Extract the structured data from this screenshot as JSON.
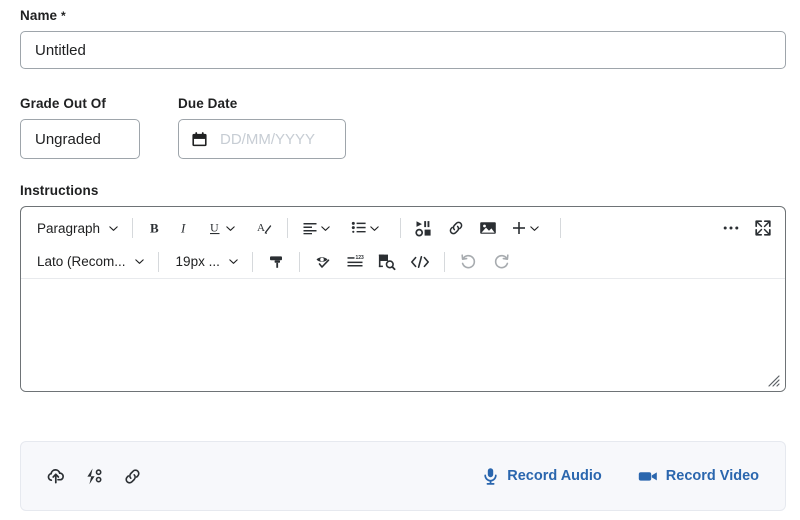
{
  "form": {
    "name_field": {
      "label": "Name",
      "required_marker": "*",
      "value": "Untitled",
      "placeholder": ""
    },
    "grade_field": {
      "label": "Grade Out Of",
      "value": "Ungraded",
      "placeholder": ""
    },
    "due_date_field": {
      "label": "Due Date",
      "value": "",
      "placeholder": "DD/MM/YYYY",
      "icon": "calendar-icon"
    },
    "instructions_field": {
      "label": "Instructions",
      "value": ""
    }
  },
  "editor": {
    "toolbar_row1": [
      {
        "type": "combo",
        "name": "paragraph-format-select",
        "label": "Paragraph",
        "icon": "chevron-down-icon"
      },
      {
        "type": "sep"
      },
      {
        "type": "icon",
        "name": "bold-button",
        "icon": "bold-icon",
        "label": "Bold"
      },
      {
        "type": "icon",
        "name": "italic-button",
        "icon": "italic-icon",
        "label": "Italic"
      },
      {
        "type": "icon-chev",
        "name": "underline-button",
        "icon": "underline-icon",
        "label": "Underline"
      },
      {
        "type": "icon",
        "name": "text-color-button",
        "icon": "text-color-icon",
        "label": "Text Color"
      },
      {
        "type": "sep"
      },
      {
        "type": "icon-chev",
        "name": "align-button",
        "icon": "align-left-icon",
        "label": "Align"
      },
      {
        "type": "icon-chev",
        "name": "list-button",
        "icon": "bullet-list-icon",
        "label": "Lists"
      },
      {
        "type": "sep"
      },
      {
        "type": "icon",
        "name": "insert-media-button",
        "icon": "media-icon",
        "label": "Insert Media"
      },
      {
        "type": "icon",
        "name": "insert-link-button",
        "icon": "link-icon",
        "label": "Insert Link"
      },
      {
        "type": "icon",
        "name": "insert-image-button",
        "icon": "image-icon",
        "label": "Insert Image"
      },
      {
        "type": "icon-chev",
        "name": "insert-more-button",
        "icon": "plus-icon",
        "label": "Insert"
      },
      {
        "type": "sep"
      },
      {
        "type": "spacer"
      },
      {
        "type": "icon",
        "name": "more-options-button",
        "icon": "ellipsis-icon",
        "label": "More"
      },
      {
        "type": "icon",
        "name": "fullscreen-button",
        "icon": "fullscreen-icon",
        "label": "Fullscreen"
      }
    ],
    "toolbar_row2": [
      {
        "type": "combo",
        "name": "font-family-select",
        "label": "Lato (Recom...",
        "icon": "chevron-down-icon"
      },
      {
        "type": "sep"
      },
      {
        "type": "combo",
        "name": "font-size-select",
        "label": "19px ...",
        "icon": "chevron-down-icon"
      },
      {
        "type": "sep"
      },
      {
        "type": "icon",
        "name": "format-painter-button",
        "icon": "paint-roller-icon",
        "label": "Format Painter"
      },
      {
        "type": "sep"
      },
      {
        "type": "icon",
        "name": "accessibility-checker-button",
        "icon": "accessibility-check-icon",
        "label": "Accessibility Checker"
      },
      {
        "type": "icon",
        "name": "word-count-button",
        "icon": "word-count-icon",
        "label": "Word Count"
      },
      {
        "type": "icon",
        "name": "find-replace-button",
        "icon": "find-replace-icon",
        "label": "Find and Replace"
      },
      {
        "type": "icon",
        "name": "source-code-button",
        "icon": "code-icon",
        "label": "Source Code"
      },
      {
        "type": "sep"
      },
      {
        "type": "icon-disabled",
        "name": "undo-button",
        "icon": "undo-icon",
        "label": "Undo"
      },
      {
        "type": "icon-disabled",
        "name": "redo-button",
        "icon": "redo-icon",
        "label": "Redo"
      }
    ],
    "content": "",
    "resize_handle": "resize-grip-icon"
  },
  "attachment_bar": {
    "icons": [
      {
        "name": "upload-file-button",
        "icon": "cloud-upload-icon",
        "label": "Upload"
      },
      {
        "name": "quicklink-button",
        "icon": "quicklink-icon",
        "label": "Quicklink"
      },
      {
        "name": "attach-link-button",
        "icon": "link-icon",
        "label": "Attach Link"
      }
    ],
    "record_audio_label": "Record Audio",
    "record_audio_icon": "microphone-icon",
    "record_video_label": "Record Video",
    "record_video_icon": "video-camera-icon"
  },
  "colors": {
    "link_blue": "#2a66ae",
    "border_grey": "#9ea5ab",
    "editor_border": "#6e7376",
    "bottombar_bg": "#f7f8fb",
    "text": "#202122",
    "placeholder": "#c7cdd4",
    "disabled_icon": "#a7abaf"
  }
}
